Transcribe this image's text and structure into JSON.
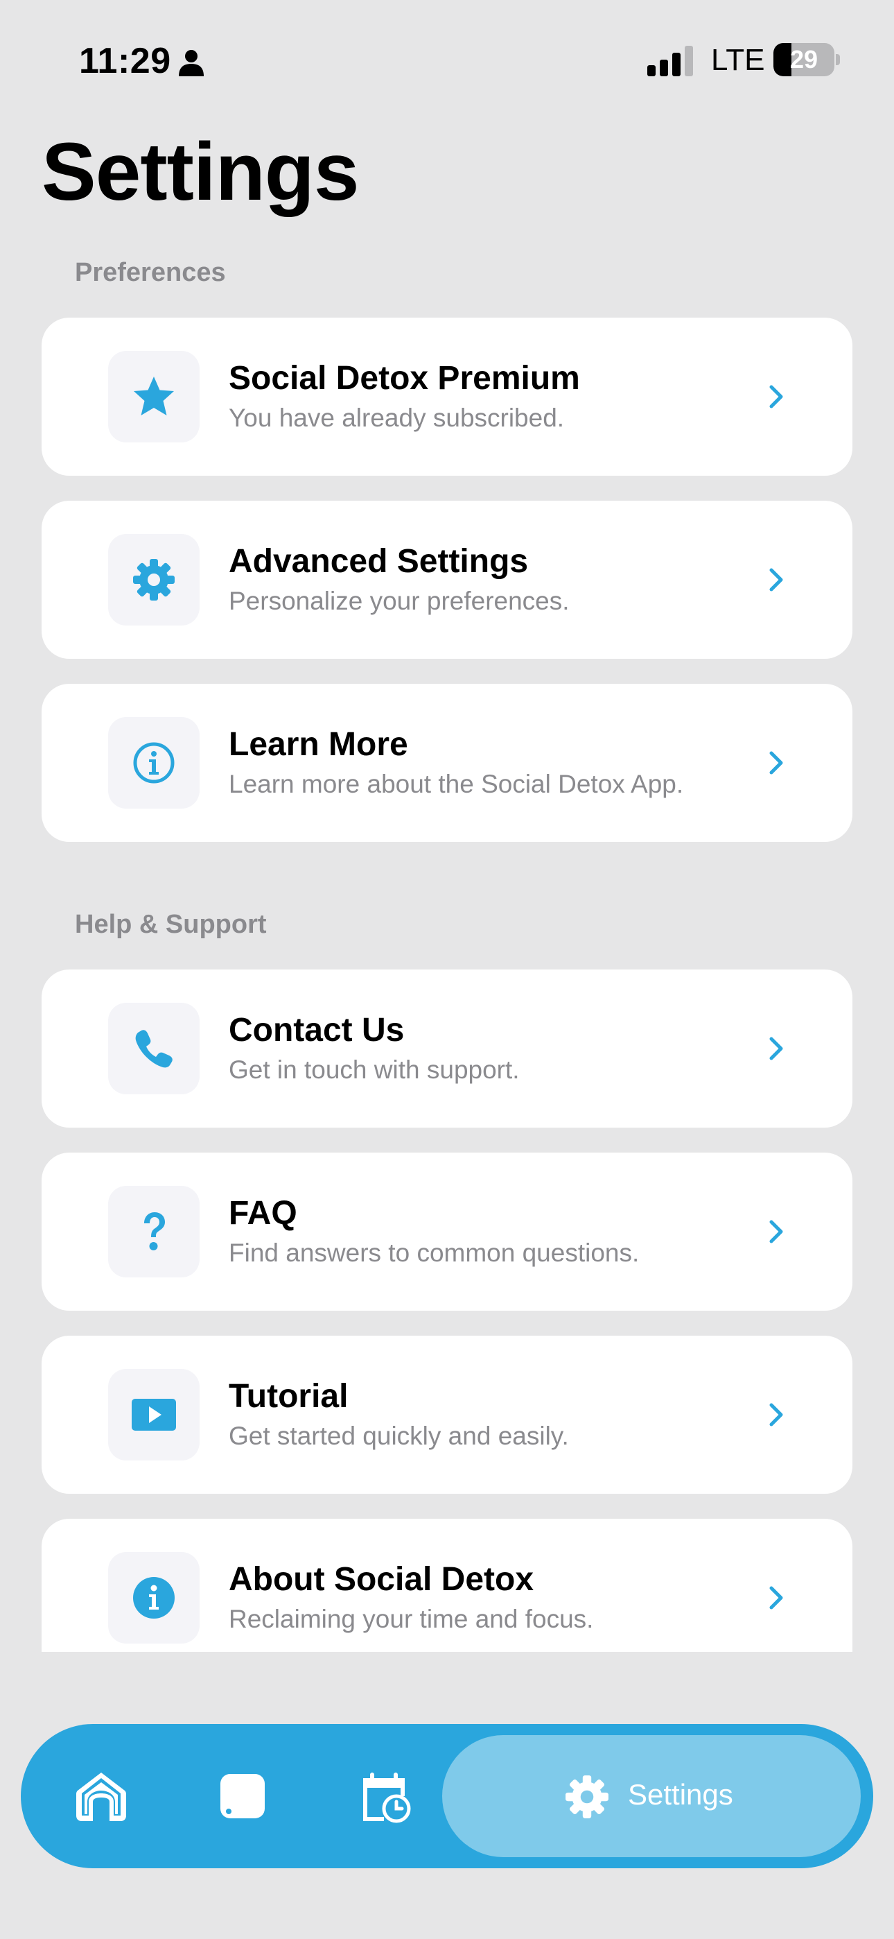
{
  "status_bar": {
    "time": "11:29",
    "network": "LTE",
    "battery": "29",
    "battery_level": 0.29
  },
  "page_title": "Settings",
  "sections": [
    {
      "label": "Preferences",
      "items": [
        {
          "title": "Social Detox Premium",
          "subtitle": "You have already subscribed.",
          "icon": "star-icon"
        },
        {
          "title": "Advanced Settings",
          "subtitle": "Personalize your preferences.",
          "icon": "gear-icon"
        },
        {
          "title": "Learn More",
          "subtitle": "Learn more about the Social Detox App.",
          "icon": "info-outline-icon"
        }
      ]
    },
    {
      "label": "Help & Support",
      "items": [
        {
          "title": "Contact Us",
          "subtitle": "Get in touch with support.",
          "icon": "phone-icon"
        },
        {
          "title": "FAQ",
          "subtitle": "Find answers to common questions.",
          "icon": "question-icon"
        },
        {
          "title": "Tutorial",
          "subtitle": "Get started quickly and easily.",
          "icon": "play-icon"
        },
        {
          "title": "About Social Detox",
          "subtitle": "Reclaiming your time and focus.",
          "icon": "info-filled-icon"
        }
      ]
    }
  ],
  "tab_bar": {
    "tabs": [
      {
        "name": "home",
        "icon": "home-icon"
      },
      {
        "name": "apps",
        "icon": "square-icon"
      },
      {
        "name": "schedule",
        "icon": "calendar-clock-icon"
      }
    ],
    "active": {
      "label": "Settings",
      "icon": "gear-icon"
    }
  },
  "colors": {
    "accent": "#2aa6dd",
    "background": "#e6e6e7",
    "active_tab": "#7fcaea"
  }
}
